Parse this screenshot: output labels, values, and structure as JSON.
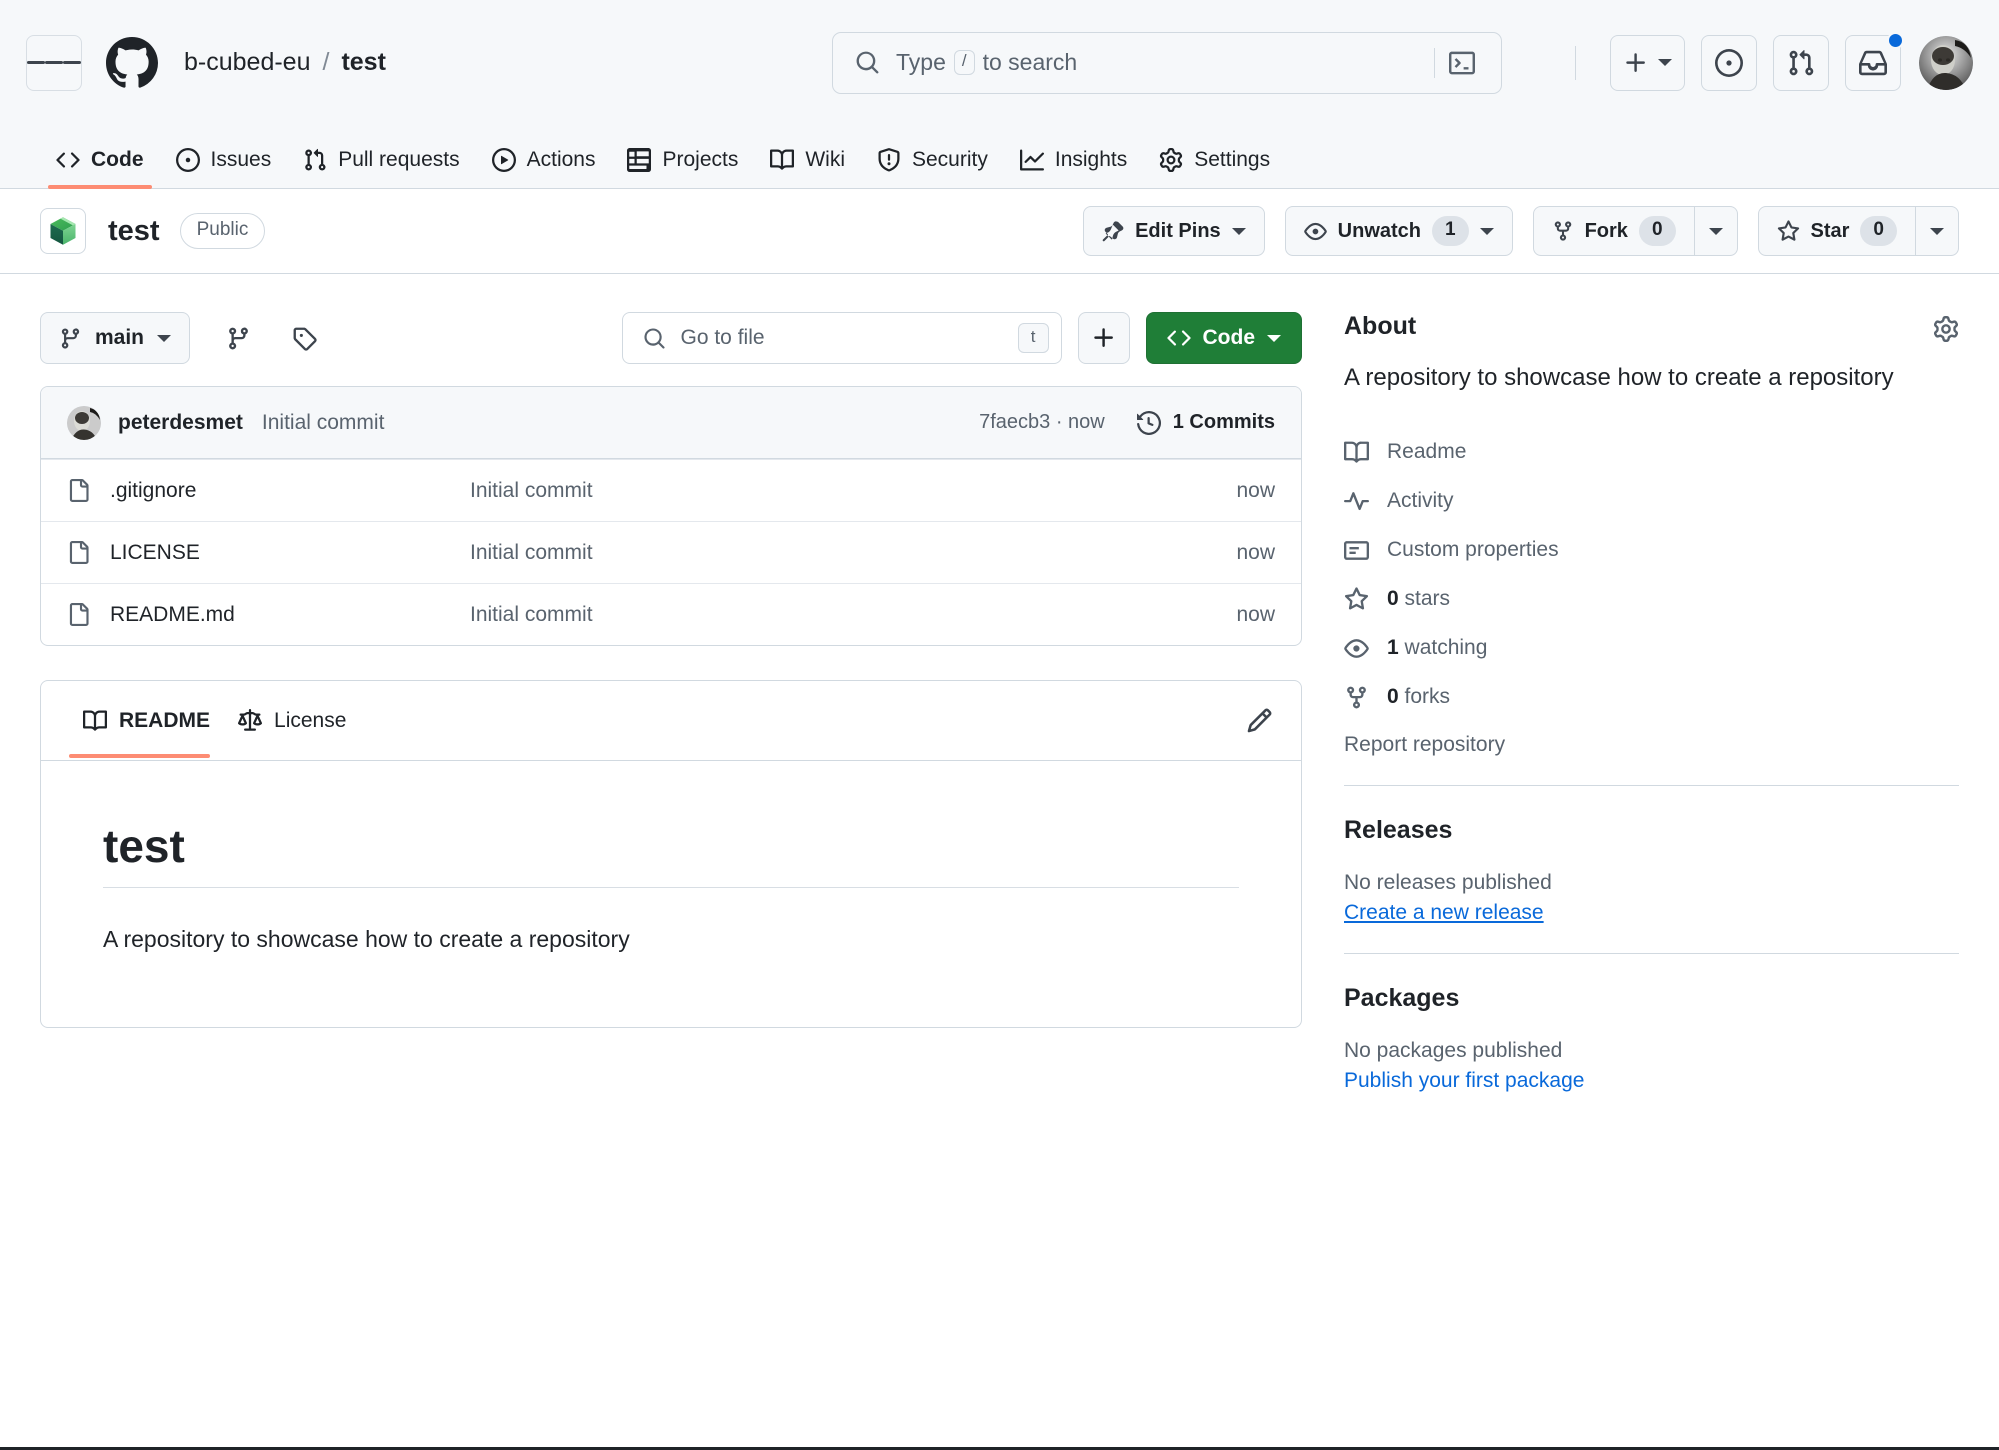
{
  "header": {
    "hamburger_label": "Open global navigation menu",
    "logo": "github-logo",
    "owner": "b-cubed-eu",
    "separator": "/",
    "repo": "test",
    "search": {
      "placeholder_prefix": "Type",
      "placeholder_key": "/",
      "placeholder_suffix": "to search",
      "value": ""
    },
    "icons": {
      "terminal": "terminal-icon",
      "create_new": "plus-icon",
      "issues": "issue-opened-icon",
      "pull_requests": "git-pull-request-icon",
      "inbox": "inbox-icon",
      "avatar": "user-avatar"
    },
    "notification_indicator": true
  },
  "repo_nav": {
    "tabs": [
      {
        "label": "Code",
        "icon": "code-icon",
        "active": true
      },
      {
        "label": "Issues",
        "icon": "issue-opened-icon",
        "active": false
      },
      {
        "label": "Pull requests",
        "icon": "git-pull-request-icon",
        "active": false
      },
      {
        "label": "Actions",
        "icon": "play-icon",
        "active": false
      },
      {
        "label": "Projects",
        "icon": "table-icon",
        "active": false
      },
      {
        "label": "Wiki",
        "icon": "book-icon",
        "active": false
      },
      {
        "label": "Security",
        "icon": "shield-icon",
        "active": false
      },
      {
        "label": "Insights",
        "icon": "graph-icon",
        "active": false
      },
      {
        "label": "Settings",
        "icon": "gear-icon",
        "active": false
      }
    ]
  },
  "repo_header": {
    "icon": "repo-stack-icon",
    "name": "test",
    "visibility": "Public",
    "actions": {
      "edit_pins": "Edit Pins",
      "watch": "Unwatch",
      "watch_count": "1",
      "fork": "Fork",
      "fork_count": "0",
      "star": "Star",
      "star_count": "0"
    }
  },
  "file_toolbar": {
    "branch": "main",
    "branches_icon": "git-branch-icon",
    "tags_icon": "tag-icon",
    "go_to_file_placeholder": "Go to file",
    "go_to_file_value": "",
    "go_to_file_key": "t",
    "add_file": "+",
    "code_button": "Code"
  },
  "latest_commit": {
    "author": "peterdesmet",
    "message": "Initial commit",
    "sha": "7faecb3",
    "separator": "·",
    "time": "now",
    "commits_label": "1 Commits"
  },
  "files": [
    {
      "icon": "file-icon",
      "name": ".gitignore",
      "message": "Initial commit",
      "time": "now"
    },
    {
      "icon": "file-icon",
      "name": "LICENSE",
      "message": "Initial commit",
      "time": "now"
    },
    {
      "icon": "file-icon",
      "name": "README.md",
      "message": "Initial commit",
      "time": "now"
    }
  ],
  "readme": {
    "tabs": [
      {
        "label": "README",
        "icon": "book-icon",
        "active": true
      },
      {
        "label": "License",
        "icon": "law-icon",
        "active": false
      }
    ],
    "edit_icon": "pencil-icon",
    "heading": "test",
    "paragraph": "A repository to showcase how to create a repository"
  },
  "sidebar": {
    "about_title": "About",
    "settings_icon": "gear-icon",
    "description": "A repository to showcase how to create a repository",
    "links": [
      {
        "icon": "book-icon",
        "label": "Readme"
      },
      {
        "icon": "pulse-icon",
        "label": "Activity"
      },
      {
        "icon": "properties-icon",
        "label": "Custom properties"
      },
      {
        "icon": "star-icon",
        "count": "0",
        "label": "stars"
      },
      {
        "icon": "eye-icon",
        "count": "1",
        "label": "watching"
      },
      {
        "icon": "fork-icon",
        "count": "0",
        "label": "forks"
      }
    ],
    "report": "Report repository",
    "releases": {
      "title": "Releases",
      "empty": "No releases published",
      "link": "Create a new release"
    },
    "packages": {
      "title": "Packages",
      "empty": "No packages published",
      "link": "Publish your first package"
    }
  },
  "colors": {
    "accent_green": "#1f7e37",
    "accent_orange": "#fd8c73",
    "link_blue": "#0969da",
    "header_bg": "#f6f8fa",
    "border": "#d1d9e0",
    "muted_text": "#59636e"
  }
}
